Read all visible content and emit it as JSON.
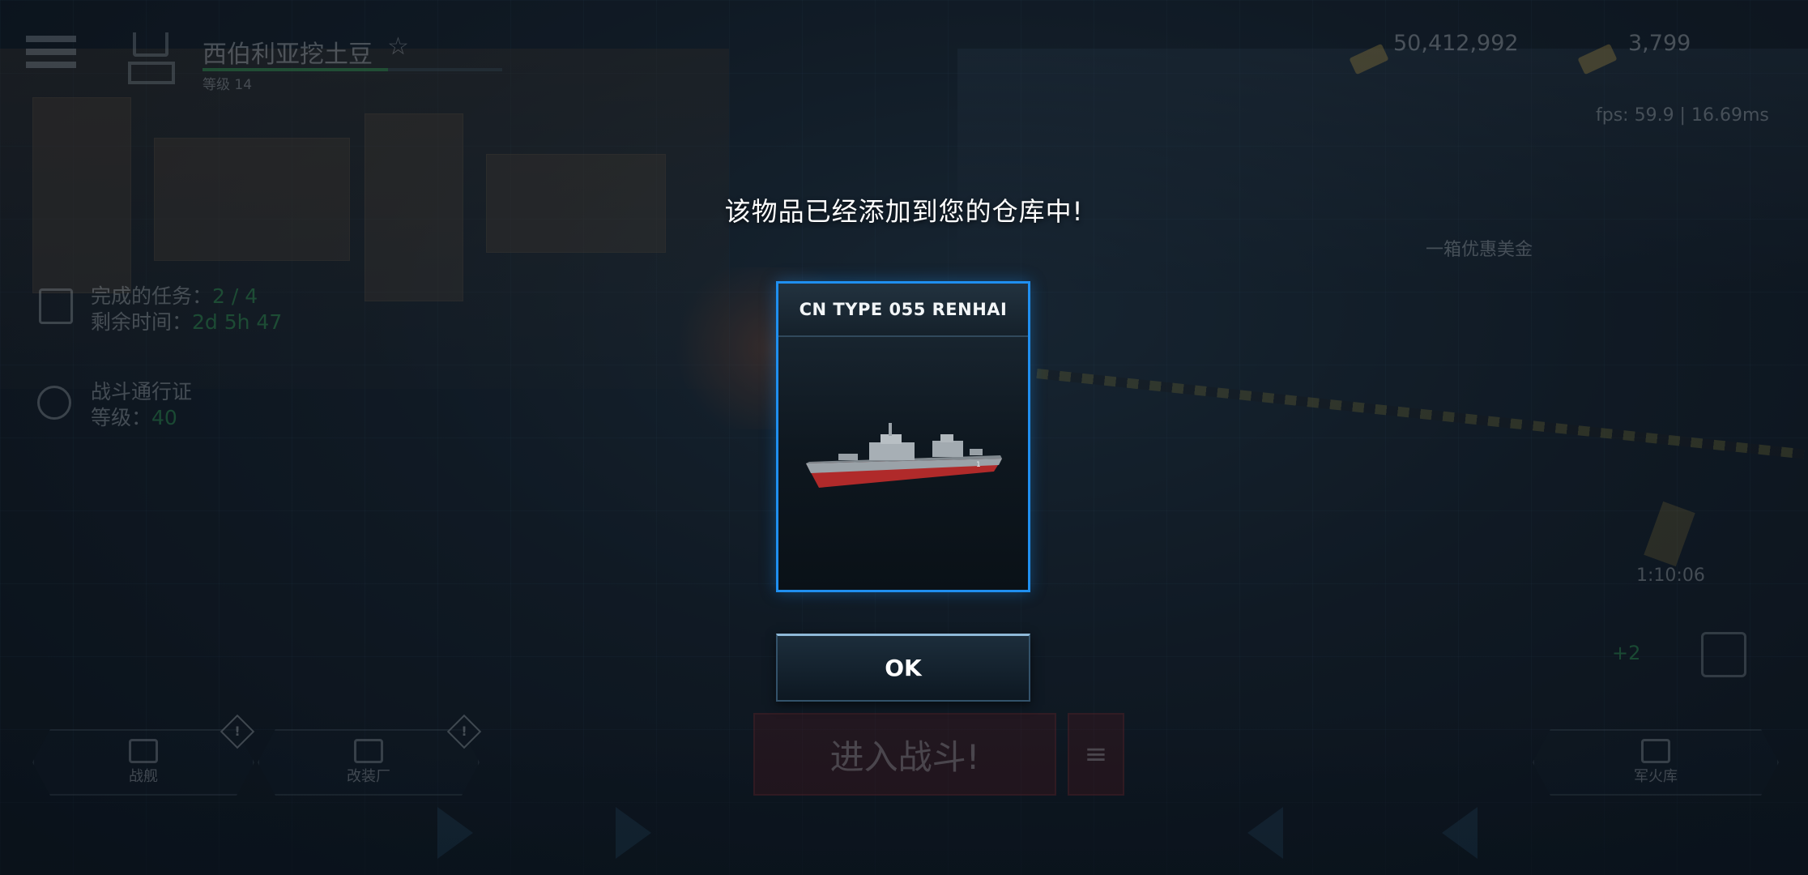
{
  "player": {
    "name": "西伯利亚挖土豆",
    "level_label": "等级 14",
    "xp_progress": 0.62
  },
  "currency": {
    "silver": "50,412,992",
    "gold": "3,799"
  },
  "perf": {
    "fps": "fps: 59.9 | 16.69ms"
  },
  "missions": {
    "completed_label": "完成的任务：",
    "completed_value": "2 / 4",
    "time_label": "剩余时间：",
    "time_value": "2d 5h 47"
  },
  "battle_pass": {
    "title": "战斗通行证",
    "level_label": "等级：",
    "level_value": "40"
  },
  "promo": {
    "offer_text": "一箱优惠美金",
    "timer": "1:10:06",
    "plus": "+2"
  },
  "bottom_nav": {
    "fleet_label": "战舰",
    "shipyard_label": "改装厂",
    "arsenal_label": "军火库",
    "warn_glyph": "!"
  },
  "battle": {
    "label": "进入战斗!",
    "menu_glyph": "≡"
  },
  "dialog": {
    "title": "该物品已经添加到您的仓库中!",
    "item_name": "CN TYPE 055 RENHAI",
    "ok_label": "OK"
  },
  "colors": {
    "card_border": "#1f8ff0",
    "accent_green": "#3fd46a",
    "ship_hull": "#b02a2a",
    "ship_deck": "#8e969c"
  },
  "icons": {
    "menu": "hamburger-menu-icon",
    "rank": "rank-chevron-icon",
    "favorite": "star-icon",
    "mission": "calendar-icon",
    "pass": "battle-pass-icon",
    "warning": "warning-icon"
  }
}
